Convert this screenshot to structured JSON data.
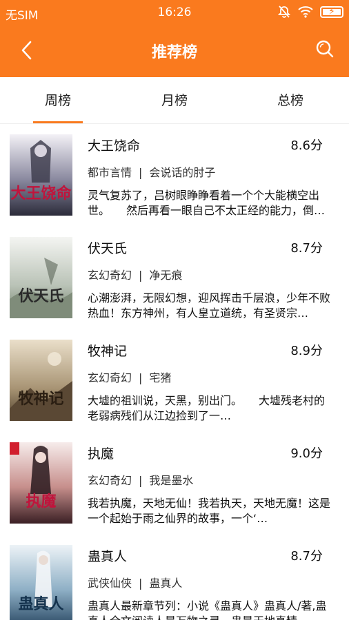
{
  "status_bar": {
    "carrier": "无SIM",
    "time": "16:26"
  },
  "nav": {
    "title": "推荐榜"
  },
  "tabs": [
    {
      "label": "周榜",
      "active": true
    },
    {
      "label": "月榜",
      "active": false
    },
    {
      "label": "总榜",
      "active": false
    }
  ],
  "books": [
    {
      "title": "大王饶命",
      "score": "8.6分",
      "category": "都市言情",
      "author": "会说话的肘子",
      "desc": "灵气复苏了，吕树眼睁睁看着一个个大能横空出世。　　然后再看一眼自己不太正经的能力，倒吸…",
      "cover_text": "大王饶命",
      "cover_colors": [
        "#e9e6ef",
        "#8b8aa0",
        "#2b2b3a"
      ]
    },
    {
      "title": "伏天氏",
      "score": "8.7分",
      "category": "玄幻奇幻",
      "author": "净无痕",
      "desc": "心潮澎湃，无限幻想，迎风挥击千层浪，少年不败热血！东方神州，有人皇立道统，有圣贤宗…",
      "cover_text": "伏天氏",
      "cover_colors": [
        "#eef0ec",
        "#b9c2b6",
        "#6f7f6a"
      ]
    },
    {
      "title": "牧神记",
      "score": "8.9分",
      "category": "玄幻奇幻",
      "author": "宅猪",
      "desc": "大墟的祖训说，天黑，别出门。　　大墟残老村的老弱病残们从江边捡到了一…",
      "cover_text": "牧神记",
      "cover_colors": [
        "#e2d7c2",
        "#a89474",
        "#4c3d2a"
      ]
    },
    {
      "title": "执魔",
      "score": "9.0分",
      "category": "玄幻奇幻",
      "author": "我是墨水",
      "desc": "我若执魔，天地无仙！我若执天，天地无魔！这是一个起始于雨之仙界的故事，一个‘…",
      "cover_text": "执魔",
      "cover_colors": [
        "#f1e6e4",
        "#c78f8c",
        "#3a1f24"
      ]
    },
    {
      "title": "蛊真人",
      "score": "8.7分",
      "category": "武侠仙侠",
      "author": "蛊真人",
      "desc": "蛊真人最新章节列：小说《蛊真人》蛊真人/著,蛊真人全文阅读人是万物之灵，蛊是天地真精…",
      "cover_text": "蛊真人",
      "cover_colors": [
        "#e3ecf2",
        "#8fb0c6",
        "#2c4b66"
      ]
    }
  ],
  "colors": {
    "accent": "#fa7a1e",
    "header_text": "#ffffff"
  }
}
